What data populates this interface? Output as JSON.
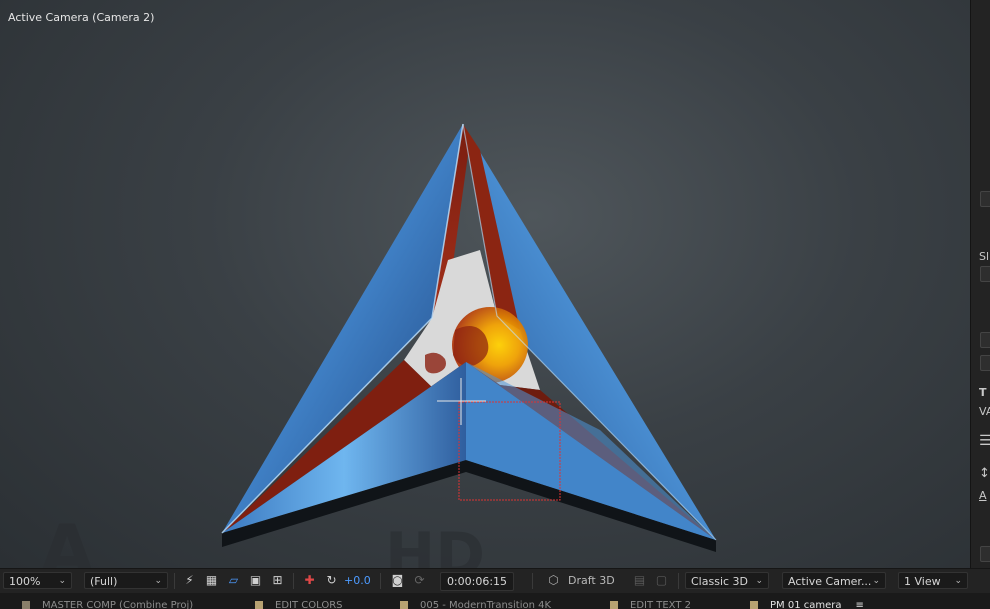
{
  "viewer": {
    "label": "Active Camera (Camera 2)"
  },
  "toolbar": {
    "zoom": "100%",
    "resolution": "(Full)",
    "exposure": "+0.0",
    "timecode": "0:00:06:15",
    "renderer_toggle": "Draft 3D",
    "renderer": "Classic 3D",
    "camera": "Active Camer...",
    "views": "1 View"
  },
  "right_panel": {
    "fragments": [
      "Sl",
      "T",
      "VA",
      "A"
    ]
  },
  "tabs": [
    {
      "label": "MASTER COMP (Combine Proj)",
      "color": "#8a7f6a"
    },
    {
      "label": "EDIT COLORS",
      "color": "#b8a272"
    },
    {
      "label": "005 - ModernTransition 4K",
      "color": "#b8a272"
    },
    {
      "label": "EDIT TEXT 2",
      "color": "#b8a272"
    },
    {
      "label": "PM 01 camera",
      "color": "#b8a272",
      "active": true
    }
  ],
  "colors": {
    "accent": "#4d9bff",
    "viewer_bg": "#3a4045",
    "panel_bg": "#232323"
  }
}
